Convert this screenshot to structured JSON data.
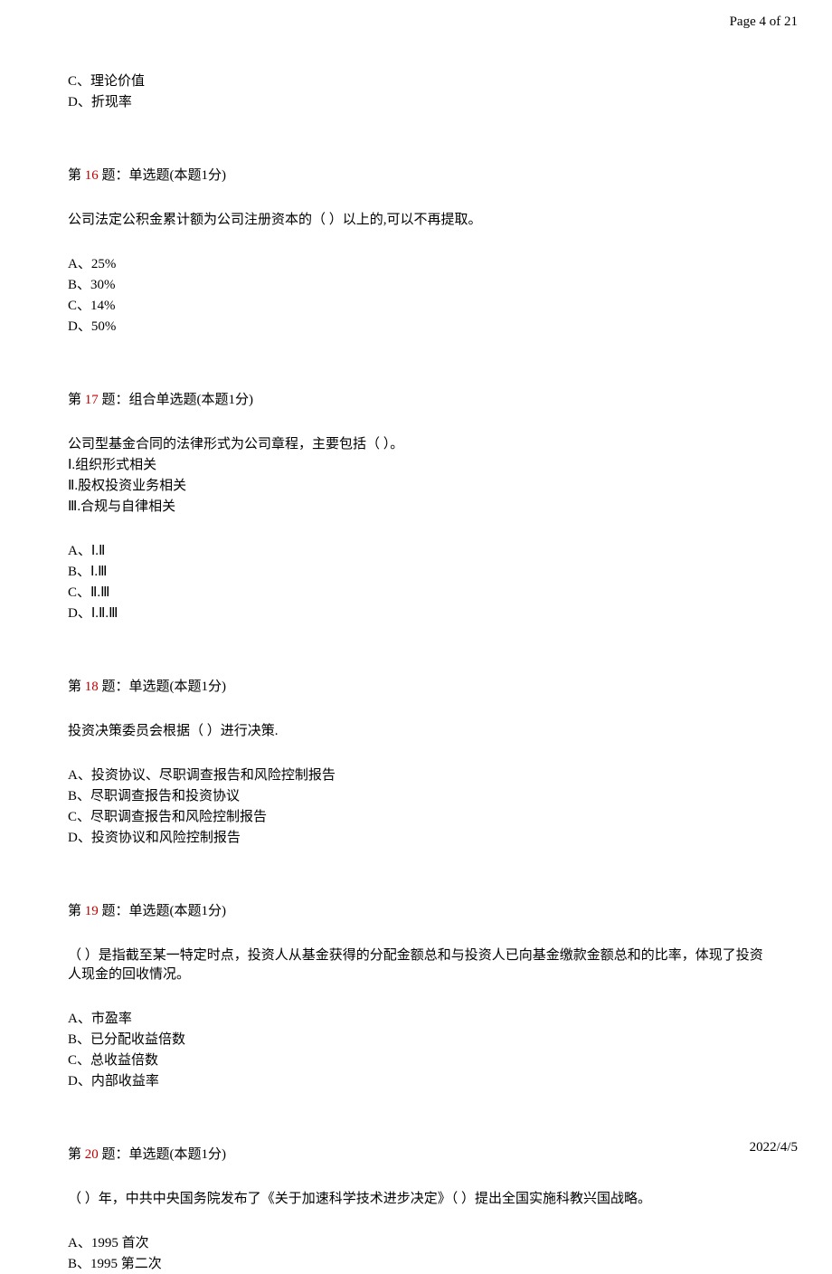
{
  "header": {
    "page_label": "Page 4 of 21"
  },
  "footer": {
    "date": "2022/4/5"
  },
  "top_options": [
    "C、理论价值",
    "D、折现率"
  ],
  "questions": [
    {
      "prefix": "第 ",
      "num": "16",
      "suffix": " 题：单选题(本题1分)",
      "stem": [
        "公司法定公积金累计额为公司注册资本的（ ）以上的,可以不再提取。"
      ],
      "options": [
        "A、25%",
        "B、30%",
        "C、14%",
        "D、50%"
      ]
    },
    {
      "prefix": "第 ",
      "num": "17",
      "suffix": " 题：组合单选题(本题1分)",
      "stem": [
        "公司型基金合同的法律形式为公司章程，主要包括（  ）。",
        "Ⅰ.组织形式相关",
        "Ⅱ.股权投资业务相关",
        "Ⅲ.合规与自律相关"
      ],
      "options": [
        "A、Ⅰ.Ⅱ",
        "B、Ⅰ.Ⅲ",
        "C、Ⅱ.Ⅲ",
        "D、Ⅰ.Ⅱ.Ⅲ"
      ]
    },
    {
      "prefix": "第 ",
      "num": "18",
      "suffix": " 题：单选题(本题1分)",
      "stem": [
        "投资决策委员会根据（ ）进行决策."
      ],
      "options": [
        "A、投资协议、尽职调查报告和风险控制报告",
        "B、尽职调查报告和投资协议",
        "C、尽职调查报告和风险控制报告",
        "D、投资协议和风险控制报告"
      ]
    },
    {
      "prefix": "第 ",
      "num": "19",
      "suffix": " 题：单选题(本题1分)",
      "stem": [
        "（  ）是指截至某一特定时点，投资人从基金获得的分配金额总和与投资人已向基金缴款金额总和的比率，体现了投资人现金的回收情况。"
      ],
      "options": [
        "A、市盈率",
        "B、已分配收益倍数",
        "C、总收益倍数",
        "D、内部收益率"
      ]
    },
    {
      "prefix": "第 ",
      "num": "20",
      "suffix": " 题：单选题(本题1分)",
      "stem": [
        "（ ）年，中共中央国务院发布了《关于加速科学技术进步决定》（  ）提出全国实施科教兴国战略。"
      ],
      "options": [
        "A、1995 首次",
        "B、1995 第二次"
      ]
    }
  ]
}
